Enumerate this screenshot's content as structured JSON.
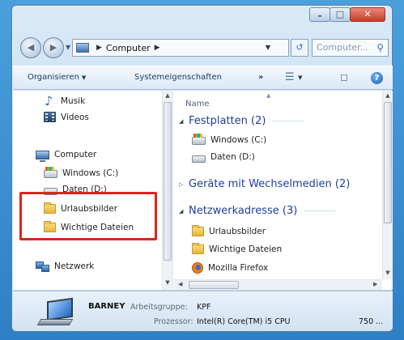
{
  "window": {
    "caption_buttons": {
      "minimize": "–",
      "maximize": "□",
      "close": "✕"
    }
  },
  "nav": {
    "back_icon": "back-arrow-icon",
    "forward_icon": "forward-arrow-icon",
    "address": {
      "crumbs": [
        "Computer"
      ]
    },
    "search_placeholder": "Computer..."
  },
  "toolbar": {
    "organize": "Organisieren",
    "system_properties": "Systemeigenschaften",
    "overflow": "»"
  },
  "navpane": {
    "items": [
      {
        "label": "Musik",
        "icon": "music-icon"
      },
      {
        "label": "Videos",
        "icon": "videos-icon"
      },
      {
        "label": "Computer",
        "icon": "computer-icon"
      },
      {
        "label": "Windows (C:)",
        "icon": "windows-drive-icon"
      },
      {
        "label": "Daten (D:)",
        "icon": "drive-icon"
      },
      {
        "label": "Urlaubsbilder",
        "icon": "folder-icon"
      },
      {
        "label": "Wichtige Dateien",
        "icon": "folder-icon"
      },
      {
        "label": "Netzwerk",
        "icon": "network-icon"
      }
    ]
  },
  "filepane": {
    "column_header": "Name",
    "groups": [
      {
        "title": "Festplatten (2)",
        "expanded": true,
        "items": [
          {
            "label": "Windows (C:)",
            "icon": "windows-drive-icon"
          },
          {
            "label": "Daten (D:)",
            "icon": "drive-icon"
          }
        ]
      },
      {
        "title": "Geräte mit Wechselmedien (2)",
        "expanded": false,
        "items": []
      },
      {
        "title": "Netzwerkadresse (3)",
        "expanded": true,
        "items": [
          {
            "label": "Urlaubsbilder",
            "icon": "folder-icon"
          },
          {
            "label": "Wichtige Dateien",
            "icon": "folder-icon"
          },
          {
            "label": "Mozilla Firefox",
            "icon": "firefox-icon"
          }
        ]
      }
    ]
  },
  "details": {
    "computer_name": "BARNEY",
    "workgroup_label": "Arbeitsgruppe:",
    "workgroup_value": "KPF",
    "processor_label": "Prozessor:",
    "processor_value": "Intel(R) Core(TM) i5 CPU",
    "processor_extra": "750 ..."
  },
  "colors": {
    "highlight_box": "#d9271e",
    "group_title": "#1e3f9b"
  }
}
